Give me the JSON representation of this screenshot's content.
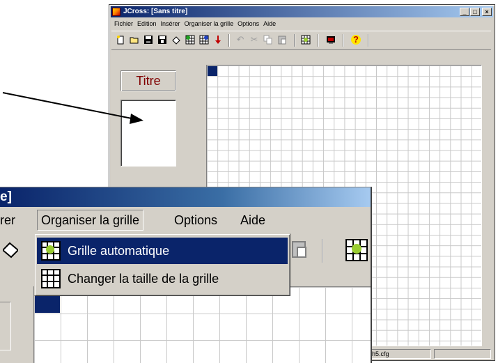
{
  "window": {
    "title": "JCross: [Sans titre]",
    "controls": [
      "_",
      "□",
      "×"
    ]
  },
  "menubar": {
    "items": [
      "Fichier",
      "Edition",
      "Insérer",
      "Organiser la grille",
      "Options",
      "Aide"
    ]
  },
  "toolbar": {
    "icons": [
      "new-icon",
      "open-icon",
      "save-icon",
      "save-as-icon",
      "clear-icon",
      "grid-icon",
      "grid-alt-icon",
      "download-arrow-icon",
      "undo-icon",
      "cut-icon",
      "copy-icon",
      "paste-icon",
      "auto-grid-icon",
      "web-export-icon",
      "help-icon"
    ]
  },
  "panel": {
    "titre_label": "Titre"
  },
  "statusbar": {
    "file": "h5.cfg"
  },
  "zoom": {
    "title_fragment": "e]",
    "menu_fragment": "rer",
    "menu_selected": "Organiser la grille",
    "menu_options": "Options",
    "menu_aide": "Aide",
    "dropdown": [
      {
        "label": "Grille automatique",
        "highlighted": true
      },
      {
        "label": "Changer la taille de la grille",
        "highlighted": false
      }
    ]
  },
  "colors": {
    "titlebar": "#0a246a",
    "highlight": "#0a246a",
    "titre_text": "#800000",
    "face": "#d4d0c8"
  }
}
